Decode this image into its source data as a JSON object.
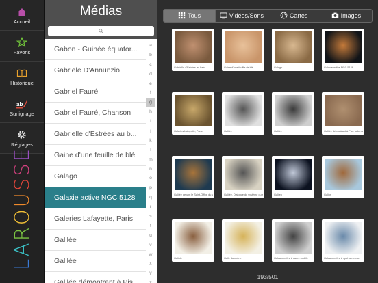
{
  "nav": {
    "items": [
      {
        "label": "Accueil",
        "icon": "home-icon",
        "color": "#b84fa9"
      },
      {
        "label": "Favoris",
        "icon": "star-icon",
        "color": "#6fbf3a"
      },
      {
        "label": "Historique",
        "icon": "book-icon",
        "color": "#e9a22d"
      },
      {
        "label": "Surlignage",
        "icon": "highlighter-icon",
        "color": "#d64a3b"
      },
      {
        "label": "Réglages",
        "icon": "gear-icon",
        "color": "#dddddd"
      }
    ],
    "brand": "LAROUSSE",
    "brand_colors": [
      "#3b7bd6",
      "#3bbfc4",
      "#7ac142",
      "#f2c037",
      "#ef8a2b",
      "#e0453a",
      "#d4417f",
      "#9b4fc2"
    ]
  },
  "panel": {
    "title": "Médias",
    "search_placeholder": "",
    "items": [
      "Gabon - Guinée équator...",
      "Gabriele D'Annunzio",
      "Gabriel Fauré",
      "Gabriel Fauré, Chanson",
      "Gabrielle d'Estrées au b...",
      "Gaine d'une feuille de blé",
      "Galago",
      "Galaxie active NGC 5128",
      "Galeries Lafayette, Paris",
      "Galilée",
      "Galilée",
      "Galilée démontrant à Pis..."
    ],
    "selected_index": 7,
    "alphabet": [
      "a",
      "b",
      "c",
      "d",
      "e",
      "f",
      "g",
      "h",
      "i",
      "j",
      "k",
      "l",
      "m",
      "n",
      "o",
      "p",
      "q",
      "r",
      "s",
      "t",
      "u",
      "v",
      "w",
      "x",
      "y",
      "z"
    ],
    "selected_letter": "g"
  },
  "tabs": [
    {
      "label": "Tous",
      "icon": "grid-icon",
      "active": true
    },
    {
      "label": "Vidéos/Sons",
      "icon": "tv-icon",
      "active": false
    },
    {
      "label": "Cartes",
      "icon": "globe-icon",
      "active": false
    },
    {
      "label": "Images",
      "icon": "camera-icon",
      "active": false
    }
  ],
  "cards": [
    {
      "caption": "Gabrielle d'Estrées au bain",
      "tone": "#7a5a3e",
      "accent": "#c09070"
    },
    {
      "caption": "Gaine d'une feuille de blé",
      "tone": "#c9956a",
      "accent": "#e8c19a"
    },
    {
      "caption": "Galago",
      "tone": "#8a6a45",
      "accent": "#d8b890"
    },
    {
      "caption": "Galaxie active NGC 5128",
      "tone": "#111418",
      "accent": "#c47a3a"
    },
    {
      "caption": "Galeries Lafayette, Paris",
      "tone": "#6b5430",
      "accent": "#c8a86a"
    },
    {
      "caption": "Galilée",
      "tone": "#e0e0e0",
      "accent": "#555555"
    },
    {
      "caption": "Galilée",
      "tone": "#cfcfcf",
      "accent": "#3a3a3a"
    },
    {
      "caption": "Galilée démontrant à Pise la loi de la chute des corps",
      "tone": "#8a6a50",
      "accent": "#b09070"
    },
    {
      "caption": "Galilée devant le Saint-Office du Vatican",
      "tone": "#1e3a50",
      "accent": "#a8743a"
    },
    {
      "caption": "Galilée, Dialogue du système du monde",
      "tone": "#d8d2c2",
      "accent": "#555555"
    },
    {
      "caption": "Galileo",
      "tone": "#0c1220",
      "accent": "#c0c8d8"
    },
    {
      "caption": "Galion",
      "tone": "#a8c8dd",
      "accent": "#a0683a"
    },
    {
      "caption": "Galiote",
      "tone": "#f2efe6",
      "accent": "#8a6040"
    },
    {
      "caption": "Galle du chêne",
      "tone": "#f3f0e4",
      "accent": "#d6b35a"
    },
    {
      "caption": "Galvanomètre à cadre mobile",
      "tone": "#cfcfcf",
      "accent": "#444444"
    },
    {
      "caption": "Galvanomètre à spot lumineux",
      "tone": "#eef0f2",
      "accent": "#6a8aaa"
    }
  ],
  "counter": "193/501"
}
